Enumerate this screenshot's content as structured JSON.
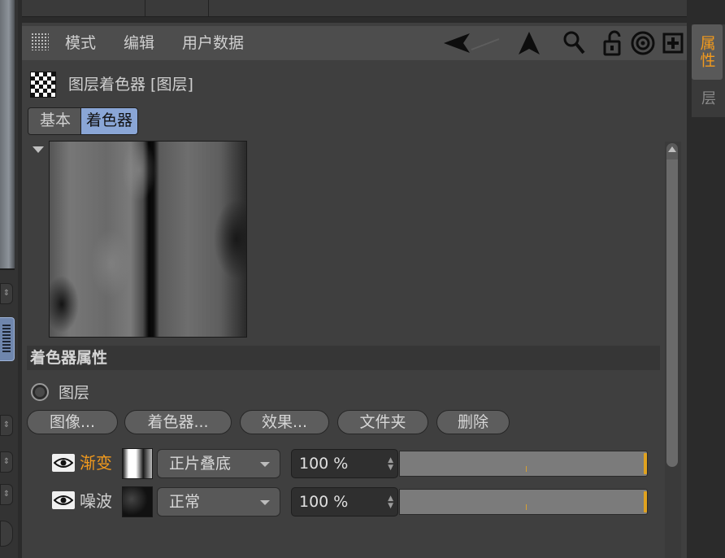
{
  "menu": {
    "items": [
      "模式",
      "编辑",
      "用户数据"
    ]
  },
  "toolbar": {
    "icons": [
      "back-arrow-icon",
      "up-arrow-icon",
      "search-icon",
      "unlock-icon",
      "target-icon",
      "add-icon"
    ]
  },
  "side_tabs": {
    "attributes": "属性",
    "layers": "层"
  },
  "object": {
    "title": "图层着色器 [图层]"
  },
  "tabs": {
    "basic": "基本",
    "shader": "着色器"
  },
  "section": {
    "title": "着色器属性"
  },
  "layer_option": {
    "label": "图层"
  },
  "buttons": {
    "image": "图像...",
    "shader": "着色器...",
    "effect": "效果...",
    "folder": "文件夹",
    "delete": "删除"
  },
  "layers": [
    {
      "name": "渐变",
      "name_color": "#f29a1d",
      "thumb": "gradient",
      "blend": "正片叠底",
      "opacity": "100 %",
      "opacity_value": 100
    },
    {
      "name": "噪波",
      "name_color": "#d0d0d0",
      "thumb": "noise",
      "blend": "正常",
      "opacity": "100 %",
      "opacity_value": 100
    }
  ],
  "colors": {
    "accent": "#f29a1d",
    "active_tab": "#8aa6d6",
    "slider_marker": "#e0a21f"
  }
}
